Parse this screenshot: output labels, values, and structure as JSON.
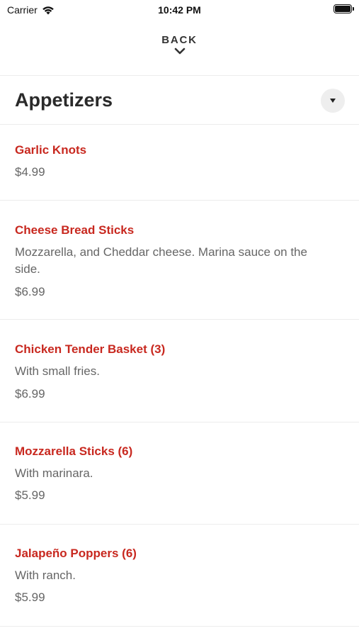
{
  "status_bar": {
    "carrier": "Carrier",
    "time": "10:42 PM"
  },
  "nav": {
    "back_label": "BACK"
  },
  "section": {
    "title": "Appetizers",
    "toggle_icon": "caret-down-icon"
  },
  "colors": {
    "accent": "#c8281f",
    "text_secondary": "#666666",
    "divider": "#ececec"
  },
  "menu_items": [
    {
      "name": "Garlic Knots",
      "description": "",
      "price": "$4.99"
    },
    {
      "name": "Cheese Bread Sticks",
      "description": "Mozzarella, and Cheddar cheese. Marina sauce on the side.",
      "price": "$6.99"
    },
    {
      "name": "Chicken Tender Basket (3)",
      "description": "With small fries.",
      "price": "$6.99"
    },
    {
      "name": "Mozzarella Sticks (6)",
      "description": "With marinara.",
      "price": "$5.99"
    },
    {
      "name": "Jalapeño Poppers (6)",
      "description": "With ranch.",
      "price": "$5.99"
    }
  ]
}
